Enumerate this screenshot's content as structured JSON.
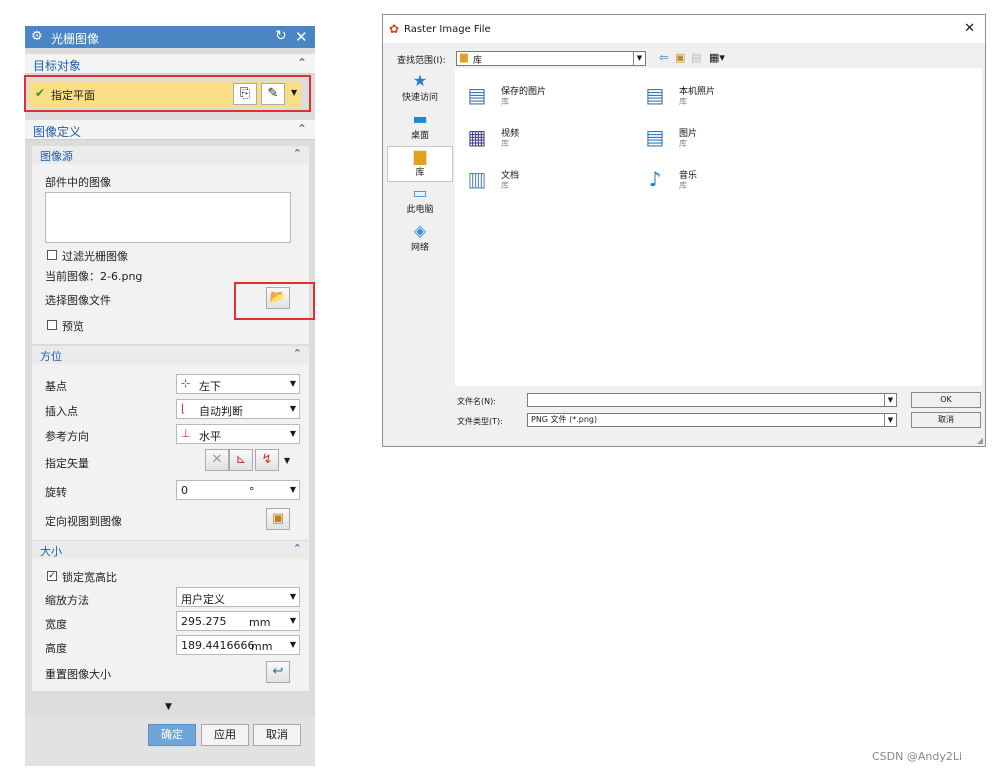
{
  "panel": {
    "title": "光栅图像",
    "target": {
      "header": "目标对象",
      "select_label": "指定平面"
    },
    "image_def": {
      "header": "图像定义",
      "source": {
        "header": "图像源",
        "part_images_label": "部件中的图像",
        "filter_label": "过滤光栅图像",
        "current_image": "当前图像：2-6.png",
        "select_file_label": "选择图像文件",
        "preview_label": "预览"
      }
    },
    "orientation": {
      "header": "方位",
      "base_point_label": "基点",
      "base_point_value": "左下",
      "insert_point_label": "插入点",
      "insert_point_value": "自动判断",
      "ref_dir_label": "参考方向",
      "ref_dir_value": "水平",
      "vector_label": "指定矢量",
      "rotate_label": "旋转",
      "rotate_value": "0",
      "rotate_unit": "°",
      "orient_view_label": "定向视图到图像"
    },
    "size": {
      "header": "大小",
      "lock_ratio_label": "锁定宽高比",
      "scale_label": "缩放方法",
      "scale_value": "用户定义",
      "width_label": "宽度",
      "width_value": "295.275",
      "width_unit": "mm",
      "height_label": "高度",
      "height_value": "189.4416666",
      "height_unit": "mm",
      "reset_label": "重置图像大小"
    },
    "buttons": {
      "ok": "确定",
      "apply": "应用",
      "cancel": "取消"
    }
  },
  "dialog": {
    "title": "Raster Image File",
    "lookin_label": "查找范围(I):",
    "lookin_value": "库",
    "places": [
      "快速访问",
      "桌面",
      "库",
      "此电脑",
      "网络"
    ],
    "files": [
      {
        "name": "保存的图片",
        "sub": "库",
        "icon": "pictures-library-icon"
      },
      {
        "name": "本机照片",
        "sub": "库",
        "icon": "camera-roll-icon"
      },
      {
        "name": "视频",
        "sub": "库",
        "icon": "videos-library-icon"
      },
      {
        "name": "图片",
        "sub": "库",
        "icon": "pictures-icon"
      },
      {
        "name": "文档",
        "sub": "库",
        "icon": "documents-icon"
      },
      {
        "name": "音乐",
        "sub": "库",
        "icon": "music-icon"
      }
    ],
    "filename_label": "文件名(N):",
    "filename_value": "",
    "filetype_label": "文件类型(T):",
    "filetype_value": "PNG 文件 (*.png)",
    "ok_label": "OK",
    "cancel_label": "取消"
  },
  "watermark": "CSDN @Andy2Li",
  "colors": {
    "title_blue": "#4a85c4",
    "highlight_yellow": "#f9de86",
    "callout_red": "#e03030",
    "section_blue": "#1c5ea8"
  }
}
